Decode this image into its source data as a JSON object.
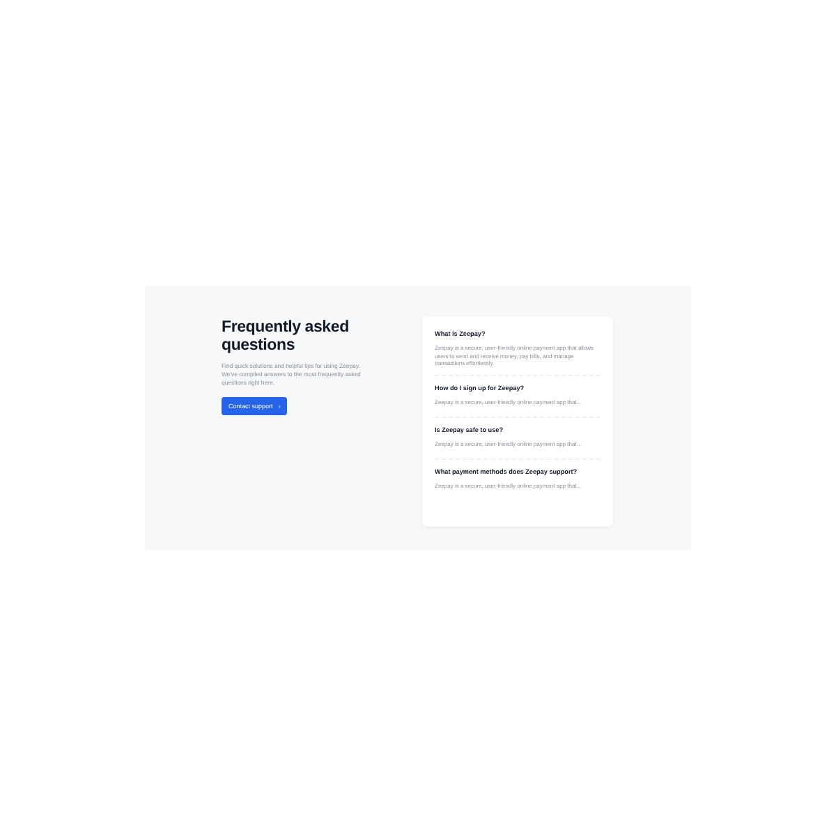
{
  "heading": "Frequently asked questions",
  "intro": "Find quick solutions and helpful tips for using Zeepay. We've compiled answers to the most frequently asked questions right here.",
  "button": {
    "label": "Contact support",
    "icon": "›"
  },
  "faqs": [
    {
      "question": "What is Zeepay?",
      "answer": "Zeepay is a secure, user-friendly online payment app that allows users to send and receive money, pay bills, and manage transactions effortlessly.",
      "expanded": true
    },
    {
      "question": "How do I sign up for Zeepay?",
      "answer": "Zeepay is a secure, user-friendly online payment app that...",
      "expanded": false
    },
    {
      "question": "Is Zeepay safe to use?",
      "answer": "Zeepay is a secure, user-friendly online payment app that...",
      "expanded": false
    },
    {
      "question": "What payment methods does Zeepay support?",
      "answer": "Zeepay is a secure, user-friendly online payment app that...",
      "expanded": false
    }
  ]
}
